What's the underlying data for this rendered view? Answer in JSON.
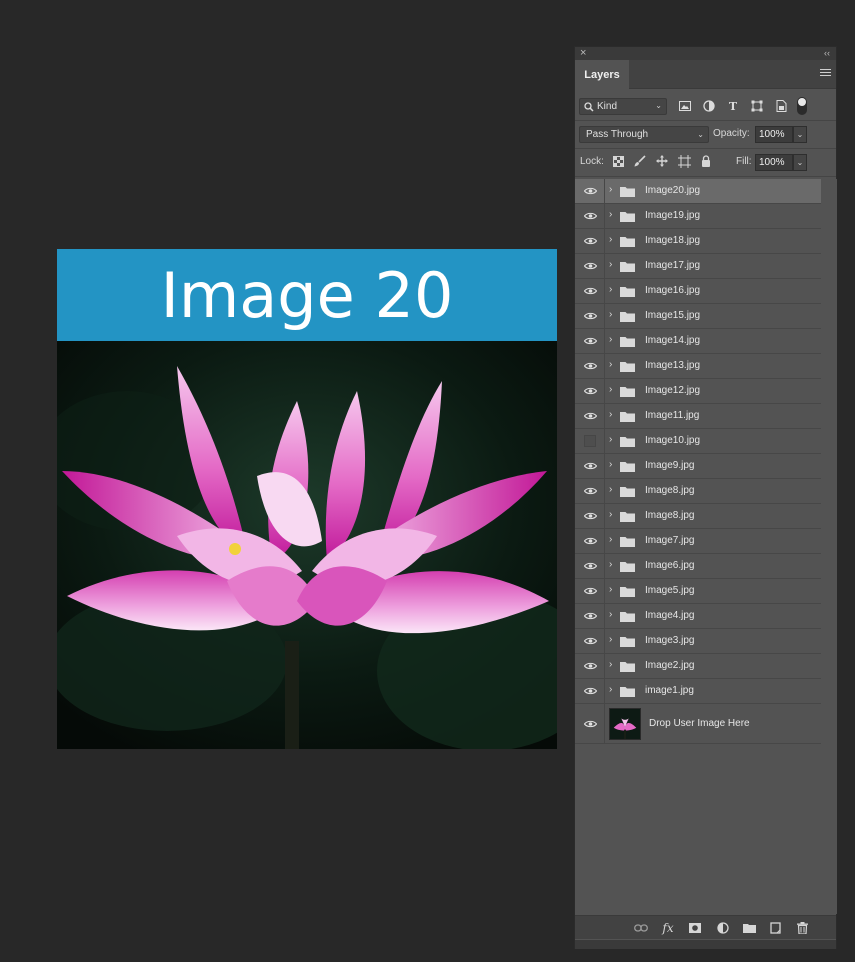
{
  "canvas": {
    "banner_text": "Image 20",
    "banner_color": "#2394c4"
  },
  "panel": {
    "tab": "Layers",
    "filter": {
      "kind_label": "Kind",
      "icons": [
        "image-filter-icon",
        "adjustment-filter-icon",
        "type-filter-icon",
        "shape-filter-icon",
        "smart-object-filter-icon"
      ]
    },
    "blend_mode": "Pass Through",
    "opacity_label": "Opacity:",
    "opacity_value": "100%",
    "lock_label": "Lock:",
    "fill_label": "Fill:",
    "fill_value": "100%",
    "layers": [
      {
        "name": "Image20.jpg",
        "visible": true,
        "selected": true
      },
      {
        "name": "Image19.jpg",
        "visible": true
      },
      {
        "name": "Image18.jpg",
        "visible": true
      },
      {
        "name": "Image17.jpg",
        "visible": true
      },
      {
        "name": "Image16.jpg",
        "visible": true
      },
      {
        "name": "Image15.jpg",
        "visible": true
      },
      {
        "name": "Image14.jpg",
        "visible": true
      },
      {
        "name": "Image13.jpg",
        "visible": true
      },
      {
        "name": "Image12.jpg",
        "visible": true
      },
      {
        "name": "Image11.jpg",
        "visible": true
      },
      {
        "name": "Image10.jpg",
        "visible": false
      },
      {
        "name": "Image9.jpg",
        "visible": true
      },
      {
        "name": "Image8.jpg",
        "visible": true
      },
      {
        "name": "Image8.jpg",
        "visible": true
      },
      {
        "name": "Image7.jpg",
        "visible": true
      },
      {
        "name": "Image6.jpg",
        "visible": true
      },
      {
        "name": "Image5.jpg",
        "visible": true
      },
      {
        "name": "Image4.jpg",
        "visible": true
      },
      {
        "name": "Image3.jpg",
        "visible": true
      },
      {
        "name": "Image2.jpg",
        "visible": true
      },
      {
        "name": "image1.jpg",
        "visible": true
      }
    ],
    "background_layer": {
      "name": "Drop User Image Here",
      "visible": true
    },
    "bottom_icons": [
      "link-layers-icon",
      "fx-icon",
      "layer-mask-icon",
      "adjustment-layer-icon",
      "new-group-icon",
      "new-layer-icon",
      "trash-icon"
    ]
  }
}
